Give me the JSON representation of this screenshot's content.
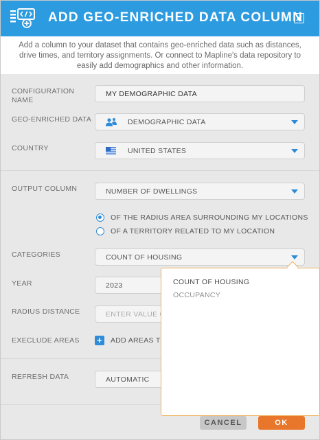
{
  "dialog": {
    "title": "ADD GEO-ENRICHED DATA COLUMN",
    "header_icon": "code-table-add-icon",
    "close_icon": "close-icon",
    "description": "Add a column to your dataset that contains geo-enriched data such as distances, drive times, and territory assignments. Or connect to Mapline's data repository to easily add demographics and other information."
  },
  "form": {
    "configuration_name": {
      "label": "CONFIGURATION NAME",
      "value": "MY DEMOGRAPHIC DATA"
    },
    "geo_enriched_data": {
      "label": "GEO-ENRICHED DATA",
      "value": "DEMOGRAPHIC DATA",
      "icon": "people-icon"
    },
    "country": {
      "label": "COUNTRY",
      "value": "UNITED STATES",
      "icon": "us-flag-icon"
    },
    "output_column": {
      "label": "OUTPUT COLUMN",
      "value": "NUMBER OF DWELLINGS"
    },
    "radio_options": [
      {
        "label": "OF THE RADIUS AREA SURROUNDING MY LOCATIONS",
        "selected": true
      },
      {
        "label": "OF A TERRITORY RELATED TO MY LOCATION",
        "selected": false
      }
    ],
    "categories": {
      "label": "CATEGORIES",
      "value": "COUNT OF HOUSING"
    },
    "year": {
      "label": "YEAR",
      "value": "2023"
    },
    "radius_distance": {
      "label": "RADIUS DISTANCE",
      "placeholder": "ENTER VALUE OF"
    },
    "exclude_areas": {
      "label": "EXECLUDE AREAS",
      "add_label": "ADD AREAS TO"
    },
    "refresh_data": {
      "label": "REFRESH DATA",
      "value": "AUTOMATIC"
    }
  },
  "categories_dropdown": {
    "options": [
      "COUNT OF HOUSING",
      "OCCUPANCY"
    ],
    "selected_index": 0
  },
  "footer": {
    "cancel_label": "CANCEL",
    "ok_label": "OK"
  },
  "colors": {
    "header_bg": "#2d9be0",
    "accent_blue": "#2d8bd8",
    "ok_orange": "#e8762b",
    "dropdown_border": "#f0b15a"
  }
}
